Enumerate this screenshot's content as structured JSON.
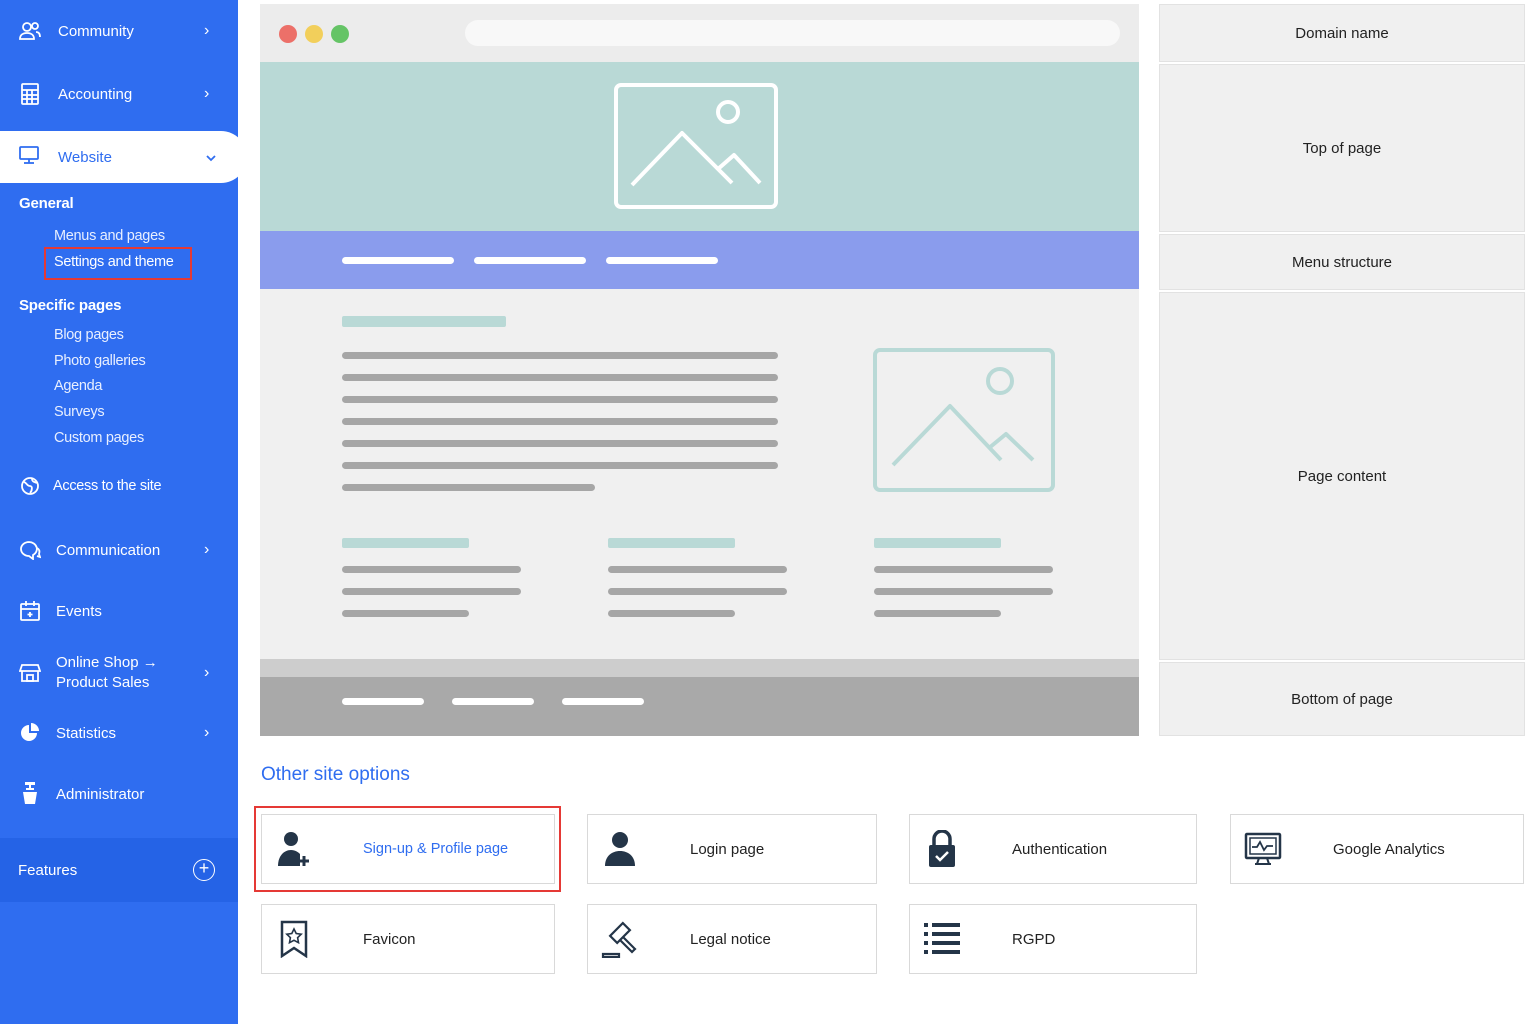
{
  "sidebar": {
    "top_items": [
      {
        "label": "Community",
        "chevron": "›"
      },
      {
        "label": "Accounting",
        "chevron": "›"
      }
    ],
    "active": {
      "label": "Website",
      "chevron": "⌄"
    },
    "general_header": "General",
    "general_items": [
      "Menus and pages",
      "Settings and theme"
    ],
    "specific_header": "Specific pages",
    "specific_items": [
      "Blog pages",
      "Photo galleries",
      "Agenda",
      "Surveys",
      "Custom pages"
    ],
    "access": "Access to the site",
    "bottom_items": [
      {
        "label": "Communication",
        "chevron": "›"
      },
      {
        "label": "Events",
        "chevron": ""
      },
      {
        "label_line1": "Online Shop →",
        "label_line2": "Product Sales",
        "chevron": "›"
      },
      {
        "label": "Statistics",
        "chevron": "›"
      },
      {
        "label": "Administrator",
        "chevron": ""
      }
    ],
    "features": {
      "label": "Features",
      "plus": "+"
    }
  },
  "zones": [
    "Domain name",
    "Top of page",
    "Menu structure",
    "Page content",
    "Bottom of page"
  ],
  "other_options": {
    "title": "Other site options",
    "cards": [
      {
        "label": "Sign-up & Profile page",
        "icon": "user-add-icon"
      },
      {
        "label": "Login page",
        "icon": "user-icon"
      },
      {
        "label": "Authentication",
        "icon": "lock-icon"
      },
      {
        "label": "Google Analytics",
        "icon": "monitor-chart-icon"
      },
      {
        "label": "Favicon",
        "icon": "bookmark-star-icon"
      },
      {
        "label": "Legal notice",
        "icon": "gavel-icon"
      },
      {
        "label": "RGPD",
        "icon": "list-icon"
      }
    ]
  },
  "colors": {
    "accent": "#2f6df0",
    "hero": "#b9d9d6",
    "menu": "#8a9ced",
    "highlight": "#e53935"
  }
}
